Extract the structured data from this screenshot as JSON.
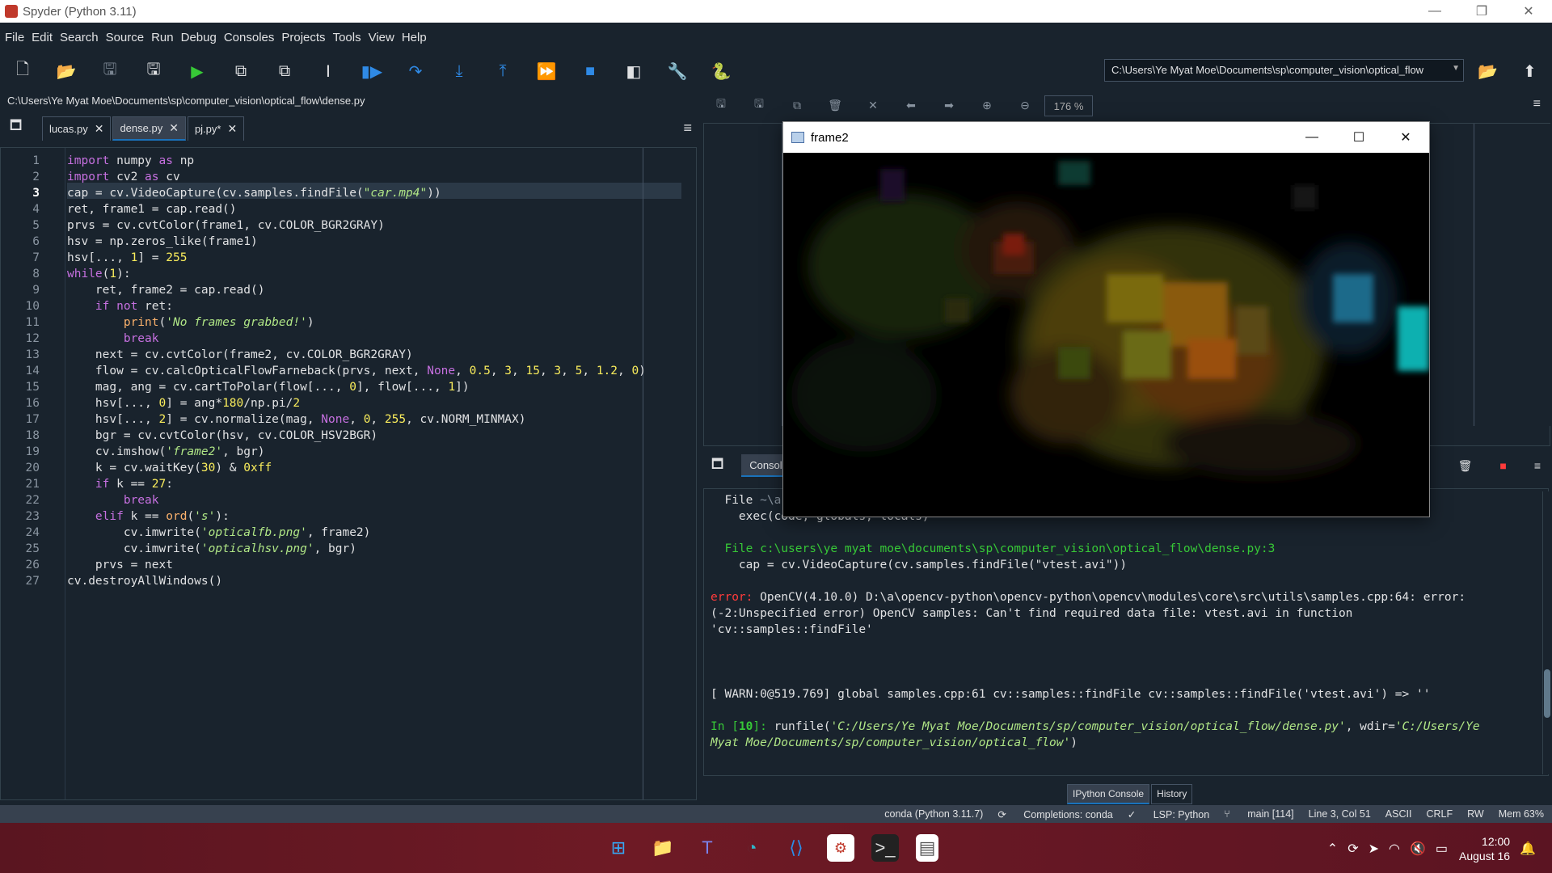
{
  "window": {
    "title": "Spyder (Python 3.11)"
  },
  "menu": [
    "File",
    "Edit",
    "Search",
    "Source",
    "Run",
    "Debug",
    "Consoles",
    "Projects",
    "Tools",
    "View",
    "Help"
  ],
  "toolbar": {
    "working_dir": "C:\\Users\\Ye Myat Moe\\Documents\\sp\\computer_vision\\optical_flow"
  },
  "editor": {
    "file_path": "C:\\Users\\Ye Myat Moe\\Documents\\sp\\computer_vision\\optical_flow\\dense.py",
    "tabs": [
      {
        "label": "lucas.py",
        "active": false
      },
      {
        "label": "dense.py",
        "active": true
      },
      {
        "label": "pj.py*",
        "active": false
      }
    ],
    "current_line": 3
  },
  "plots": {
    "zoom": "176 %"
  },
  "console": {
    "tab_label": "Console",
    "lines": [
      {
        "text": "  File ",
        "tail": "~\\a",
        "cls": ""
      },
      {
        "text": "    exec(code, globals, locals)",
        "cls": ""
      },
      {
        "text": "",
        "cls": ""
      },
      {
        "text": "  File ",
        "link": "c:\\users\\ye myat moe\\documents\\sp\\computer_vision\\optical_flow\\dense.py:3",
        "cls": ""
      },
      {
        "text": "    cap = cv.VideoCapture(cv.samples.findFile(\"vtest.avi\"))",
        "cls": ""
      },
      {
        "text": "",
        "cls": ""
      },
      {
        "text": "OpenCV(4.10.0) D:\\a\\opencv-python\\opencv-python\\opencv\\modules\\core\\src\\utils\\samples.cpp:64: error:",
        "prefix": "error: ",
        "cls": ""
      },
      {
        "text": "(-2:Unspecified error) OpenCV samples: Can't find required data file: vtest.avi in function",
        "cls": ""
      },
      {
        "text": "'cv::samples::findFile'",
        "cls": ""
      },
      {
        "text": "",
        "cls": ""
      },
      {
        "text": "",
        "cls": ""
      },
      {
        "text": "",
        "cls": ""
      },
      {
        "text": "[ WARN:0@519.769] global samples.cpp:61 cv::samples::findFile cv::samples::findFile('vtest.avi') => ''",
        "cls": ""
      },
      {
        "text": "",
        "cls": ""
      },
      {
        "prompt": "In [",
        "num": "10",
        "prompt_end": "]: ",
        "cmd": "runfile(",
        "arg1": "'C:/Users/Ye Myat Moe/Documents/sp/computer_vision/optical_flow/dense.py'",
        "mid": ", wdir=",
        "arg2": "'C:/Users/Ye"
      },
      {
        "arg2b": "Myat Moe/Documents/sp/computer_vision/optical_flow'",
        "end": ")"
      }
    ],
    "bottom_tabs": [
      "IPython Console",
      "History"
    ]
  },
  "popup": {
    "title": "frame2"
  },
  "status": {
    "env": "conda (Python 3.11.7)",
    "completions": "Completions: conda",
    "lsp": "LSP: Python",
    "git": "main [114]",
    "position": "Line 3, Col 51",
    "encoding": "ASCII",
    "eol": "CRLF",
    "rw": "RW",
    "mem": "Mem 63%"
  },
  "taskbar": {
    "time": "12:00",
    "date": "August 16"
  }
}
